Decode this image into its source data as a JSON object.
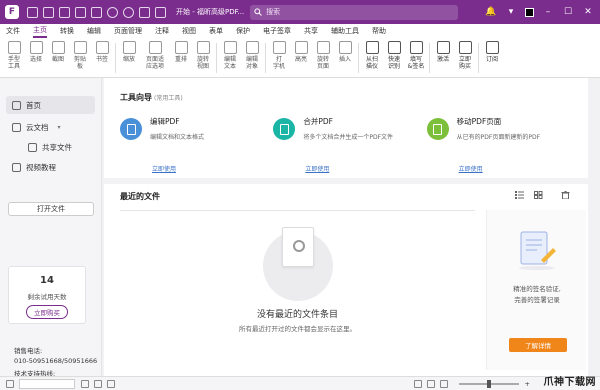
{
  "titlebar": {
    "title": "开始 - 福昕高级PDF...",
    "search_placeholder": "搜索"
  },
  "menu": [
    "文件",
    "主页",
    "转换",
    "编辑",
    "页面管理",
    "注释",
    "视图",
    "表单",
    "保护",
    "电子签章",
    "共享",
    "辅助工具",
    "帮助"
  ],
  "ribbon": {
    "tools": [
      "手型\n工具",
      "选择",
      "截图",
      "剪贴\n板",
      "书签",
      "缩放",
      "页面适\n应选项",
      "重排",
      "旋转\n视图",
      "编辑\n文本",
      "编辑\n对象",
      "打\n字机",
      "高亮",
      "旋转\n页面",
      "插入",
      "从扫\n描仪",
      "快速\n识别",
      "填写\n&签名",
      "激活",
      "立即\n购买",
      "订阅"
    ]
  },
  "sidebar": {
    "home": "首页",
    "cloud": "云文档",
    "shared": "共享文件",
    "video": "视频教程",
    "open_file": "打开文件",
    "trial_days": "14",
    "trial_label": "剩余试用天数",
    "buy_now": "立即购买",
    "hotline_label": "销售电话:",
    "hotline_number": "010-50951668/50951666",
    "tech_label": "技术支持热线:"
  },
  "wizard": {
    "title": "工具向导",
    "subtitle": "(常用工具)",
    "cards": [
      {
        "name": "编辑PDF",
        "desc": "编辑文档和文本格式",
        "link": "立即使用",
        "color": "#4a90d9"
      },
      {
        "name": "合并PDF",
        "desc": "将多个文档合并生成一个PDF文件",
        "link": "立即使用",
        "color": "#1ab5a5"
      },
      {
        "name": "移动PDF页面",
        "desc": "从已有的PDF页面新建新的PDF",
        "link": "立即使用",
        "color": "#7cbf3a"
      }
    ]
  },
  "recent": {
    "title": "最近的文件",
    "empty_title": "没有最近的文件条目",
    "empty_desc": "所有最近打开过的文件都会显示在这里。"
  },
  "promo": {
    "text_line1": "精准的签名验证,",
    "text_line2": "完善的签署记录",
    "button": "了解详情"
  },
  "statusbar": {
    "zoom": "+"
  },
  "watermark": "爪神下载网"
}
